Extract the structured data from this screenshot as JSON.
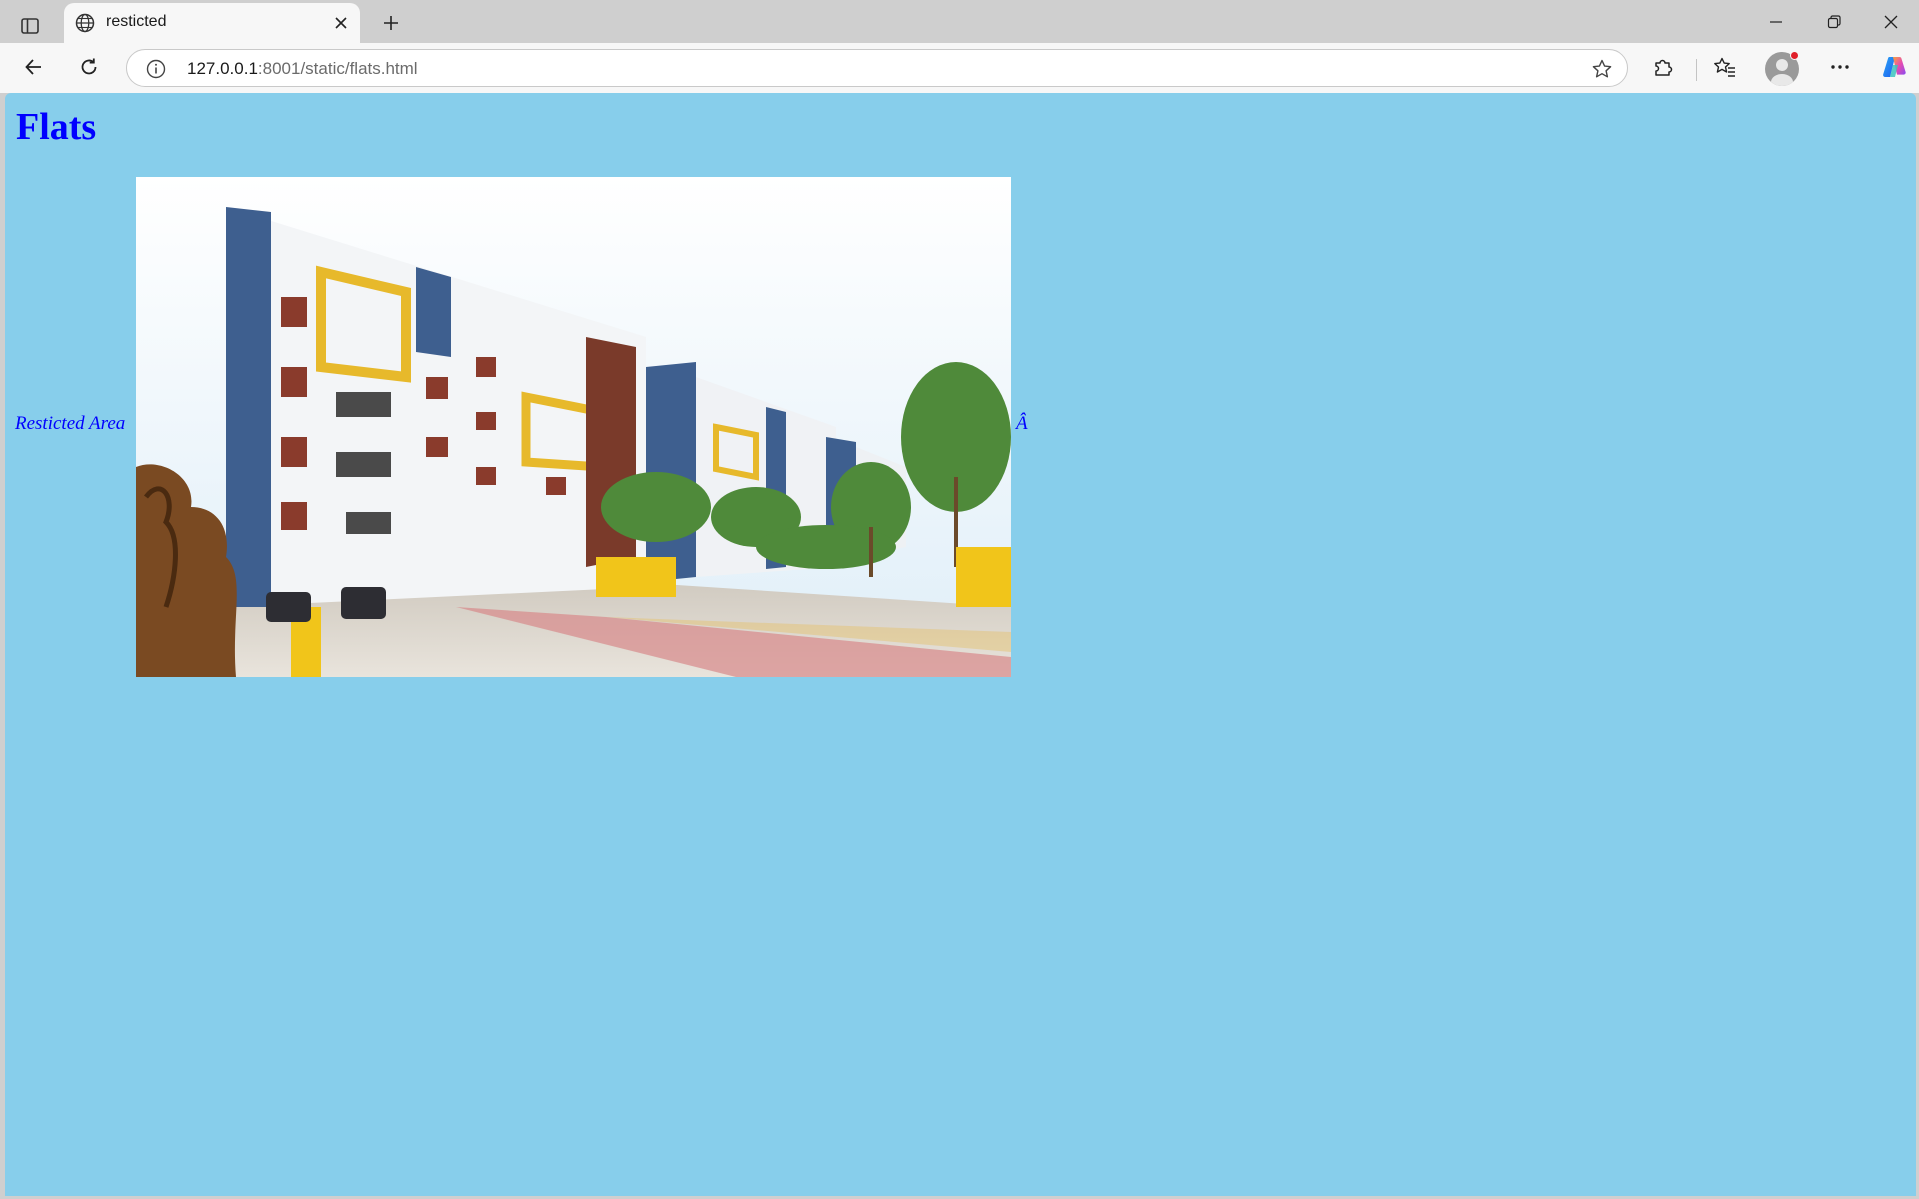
{
  "browser": {
    "tab": {
      "title": "resticted"
    },
    "address_bar": {
      "url_host": "127.0.0.1",
      "url_rest": ":8001/static/flats.html"
    },
    "icons": {
      "sidebar_toggle": "sidebar-toggle-icon",
      "favicon": "globe-icon",
      "tab_close": "close-icon",
      "new_tab": "plus-icon",
      "back": "arrow-left-icon",
      "reload": "reload-icon",
      "site_info": "info-icon",
      "favorite": "star-icon",
      "extensions": "puzzle-icon",
      "favorites": "favorites-list-icon",
      "profile": "avatar-icon",
      "menu": "ellipsis-icon",
      "copilot": "copilot-icon",
      "minimize": "minimize-icon",
      "restore": "restore-icon",
      "close_window": "close-icon"
    }
  },
  "page": {
    "background_color": "#87ceeb",
    "text_color": "#0000ff",
    "heading": "Flats",
    "left_text": "Resticted Area",
    "right_text": "Â",
    "image": {
      "subject": "apartment-building-photo"
    }
  }
}
